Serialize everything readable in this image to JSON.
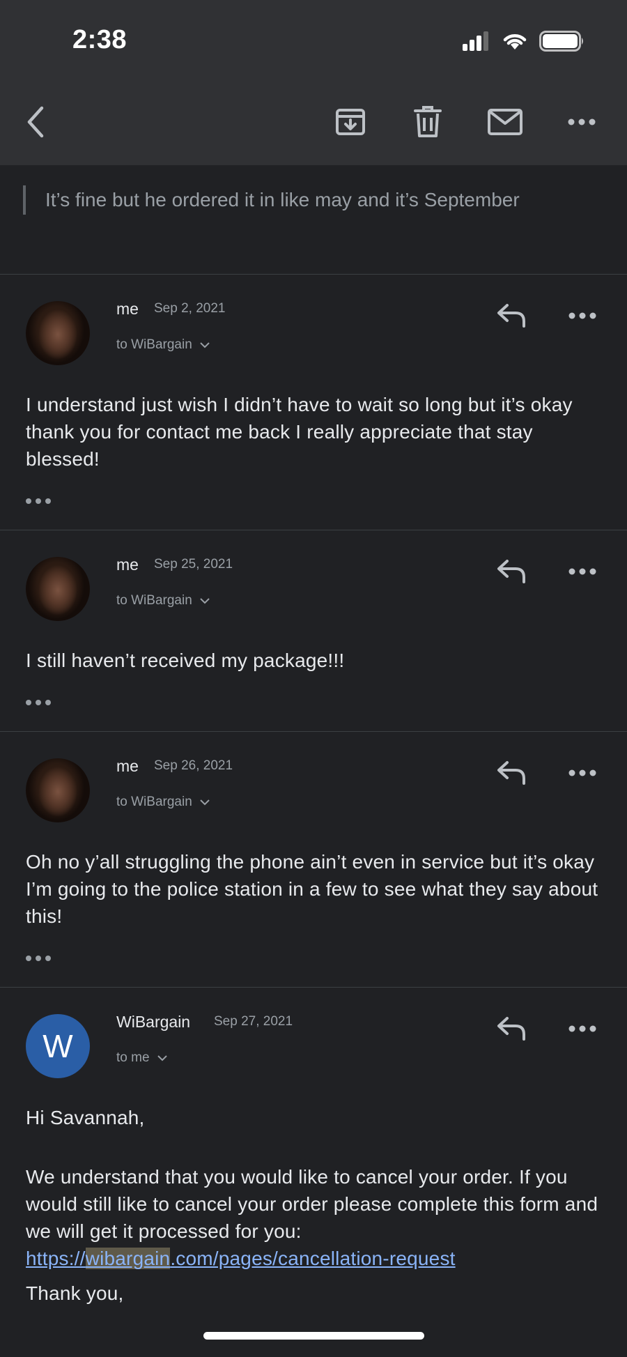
{
  "status_bar": {
    "time": "2:38"
  },
  "toolbar": {
    "icons": [
      "back-arrow-icon",
      "archive-icon",
      "trash-icon",
      "mail-icon",
      "more-horizontal-icon"
    ]
  },
  "quoted_text": "It’s fine but he ordered it in like may and it’s September",
  "messages": [
    {
      "sender": "me",
      "date": "Sep 2, 2021",
      "recipient": "to WiBargain",
      "body": "I understand just wish I didn’t have to wait so long but it’s okay thank you for contact me back I really appreciate that stay blessed!"
    },
    {
      "sender": "me",
      "date": "Sep 25, 2021",
      "recipient": "to WiBargain",
      "body": "I still haven’t received my package!!!"
    },
    {
      "sender": "me",
      "date": "Sep 26, 2021",
      "recipient": "to WiBargain",
      "body": "Oh no y’all struggling the phone ain’t even in service but it’s okay I’m going to the police station in a few to see what they say about this!"
    },
    {
      "sender": "WiBargain",
      "avatar_letter": "W",
      "date": "Sep 27, 2021",
      "recipient": "to me",
      "greeting": "Hi Savannah,",
      "paragraph": "We understand that you would like to cancel your order. If you would still like to cancel your order please complete this form and we will get it processed for you:",
      "link_prefix": "https://",
      "link_highlight": "wibargain",
      "link_suffix": ".com/pages/cancellation-request",
      "closing": "Thank you,"
    }
  ],
  "colors": {
    "background": "#202124",
    "toolbar": "#303134",
    "link": "#8ab4f8",
    "avatar_w": "#2a5ea6"
  }
}
